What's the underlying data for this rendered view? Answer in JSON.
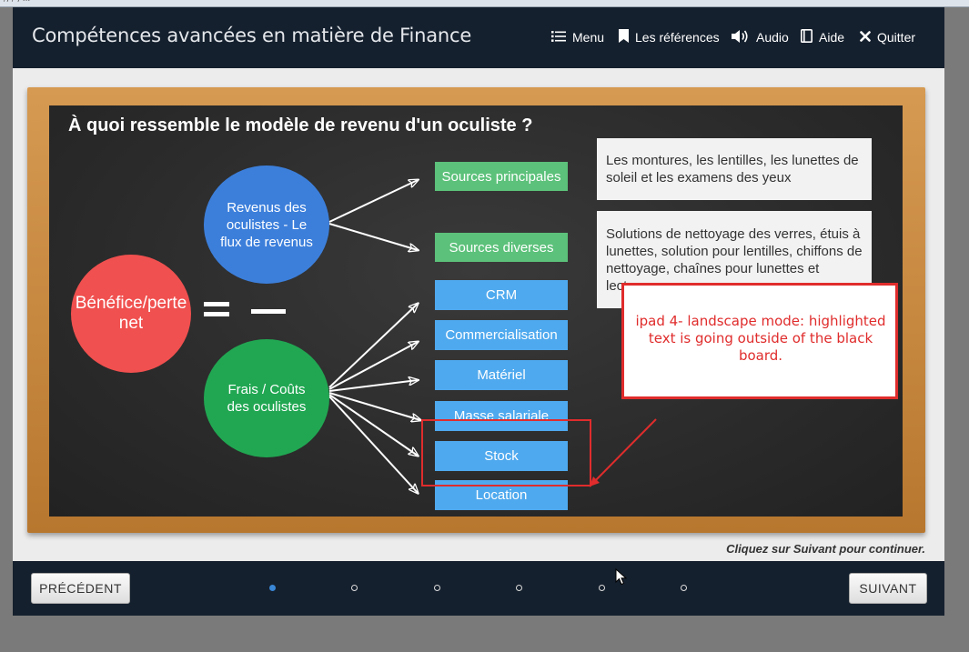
{
  "browser": {
    "strip_text": "/; / ; ..."
  },
  "header": {
    "title": "Compétences avancées en matière de Finance",
    "nav": [
      {
        "label": "Menu",
        "icon": "list-icon"
      },
      {
        "label": "Les références",
        "icon": "bookmark-icon"
      },
      {
        "label": "Audio",
        "icon": "speaker-icon"
      },
      {
        "label": "Aide",
        "icon": "book-icon"
      },
      {
        "label": "Quitter",
        "icon": "close-icon"
      }
    ]
  },
  "board": {
    "question": "À quoi ressemble le modèle de revenu d'un oculiste ?",
    "profit_circle": "Bénéfice/perte net",
    "revenue_circle": "Revenus des oculistes - Le flux de revenus",
    "costs_circle": "Frais / Coûts des oculistes",
    "equals_symbol": "=",
    "minus_symbol": "—",
    "revenue_boxes": [
      "Sources principales",
      "Sources diverses"
    ],
    "cost_boxes": [
      "CRM",
      "Commercialisation",
      "Matériel",
      "Masse salariale",
      "Stock",
      "Location"
    ],
    "notes": [
      "Les montures, les lentilles, les lunettes de soleil et les examens des yeux",
      "Solutions de nettoyage des verres, étuis à lunettes, solution pour lentilles, chiffons de nettoyage, chaînes pour lunettes et lecteurs"
    ]
  },
  "hint": "Cliquez sur Suivant pour continuer.",
  "annotation": {
    "text": "ipad 4- landscape mode: highlighted text is going outside of the black board."
  },
  "footer": {
    "prev": "PRÉCÉDENT",
    "next": "SUIVANT",
    "pages_total": 6,
    "current_page": 1
  },
  "colors": {
    "header": "#15202e",
    "green": "#5cc17a",
    "blue": "#4fa9ee",
    "profit_red": "#f0504f",
    "revenue_blue": "#3c7fdb",
    "costs_green": "#21a752",
    "annotation_red": "#e02c2c"
  }
}
